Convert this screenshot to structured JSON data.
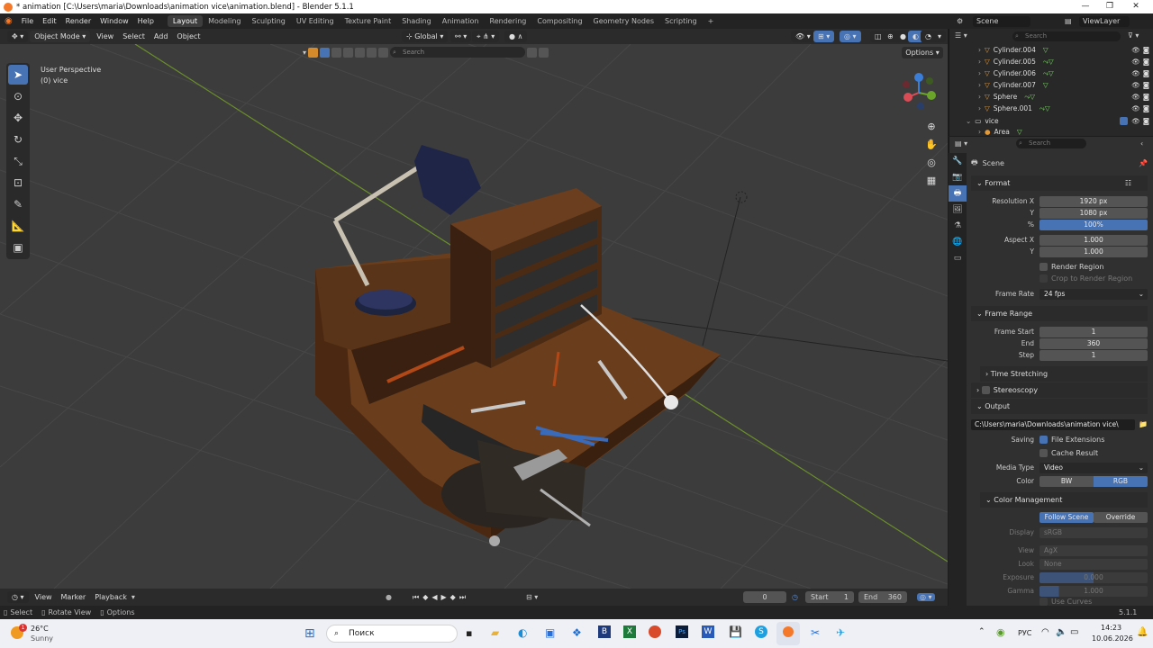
{
  "window": {
    "title": "* animation [C:\\Users\\maria\\Downloads\\animation vice\\animation.blend] - Blender 5.1.1"
  },
  "menu": [
    "File",
    "Edit",
    "Render",
    "Window",
    "Help"
  ],
  "workspaces": [
    "Layout",
    "Modeling",
    "Sculpting",
    "UV Editing",
    "Texture Paint",
    "Shading",
    "Animation",
    "Rendering",
    "Compositing",
    "Geometry Nodes",
    "Scripting"
  ],
  "active_workspace": "Layout",
  "scene_selector": "Scene",
  "viewlayer_selector": "ViewLayer",
  "viewport_header": {
    "mode": "Object Mode",
    "menus": [
      "View",
      "Select",
      "Add",
      "Object"
    ],
    "orientation": "Global"
  },
  "viewport": {
    "perspective": "User Perspective",
    "object_label": "(0) vice",
    "options_label": "Options",
    "search_placeholder": "Search"
  },
  "outliner": {
    "search_placeholder": "Search",
    "items": [
      {
        "name": "Cylinder.004"
      },
      {
        "name": "Cylinder.005"
      },
      {
        "name": "Cylinder.006"
      },
      {
        "name": "Cylinder.007"
      },
      {
        "name": "Sphere"
      },
      {
        "name": "Sphere.001"
      },
      {
        "name": "vice"
      },
      {
        "name": "Area"
      }
    ]
  },
  "properties": {
    "search_placeholder": "Search",
    "context": "Scene",
    "format": {
      "header": "Format",
      "resolution_x_label": "Resolution X",
      "resolution_x": "1920 px",
      "y_label": "Y",
      "resolution_y": "1080 px",
      "pct_label": "%",
      "resolution_pct": "100%",
      "aspect_x_label": "Aspect X",
      "aspect_x": "1.000",
      "aspect_y": "1.000",
      "render_region": "Render Region",
      "crop_region": "Crop to Render Region",
      "frame_rate_label": "Frame Rate",
      "frame_rate": "24 fps"
    },
    "frame_range": {
      "header": "Frame Range",
      "start_label": "Frame Start",
      "start": "1",
      "end_label": "End",
      "end": "360",
      "step_label": "Step",
      "step": "1"
    },
    "time_stretching": "Time Stretching",
    "stereoscopy": "Stereoscopy",
    "output": {
      "header": "Output",
      "path": "C:\\Users\\maria\\Downloads\\animation vice\\",
      "saving_label": "Saving",
      "file_ext": "File Extensions",
      "cache": "Cache Result",
      "media_type_label": "Media Type",
      "media_type": "Video",
      "color_label": "Color",
      "color_bw": "BW",
      "color_rgb": "RGB"
    },
    "color_management": {
      "header": "Color Management",
      "follow": "Follow Scene",
      "override": "Override",
      "display_label": "Display",
      "display": "sRGB",
      "view_label": "View",
      "view": "AgX",
      "look_label": "Look",
      "look": "None",
      "exposure_label": "Exposure",
      "exposure": "0.000",
      "gamma_label": "Gamma",
      "gamma": "1.000",
      "use_curves": "Use Curves"
    }
  },
  "timeline": {
    "menus": [
      "View",
      "Marker",
      "Playback"
    ],
    "current": "0",
    "start_label": "Start",
    "start": "1",
    "end_label": "End",
    "end": "360"
  },
  "statusbar": {
    "select": "Select",
    "rotate": "Rotate View",
    "options": "Options",
    "version": "5.1.1"
  },
  "taskbar": {
    "weather_temp": "26°C",
    "weather": "Sunny",
    "search": "Поиск",
    "lang": "РУС",
    "time": "14:23",
    "date": "10.06.2026",
    "badge": "1"
  },
  "colors": {
    "accent": "#4772b3",
    "viewport_bg": "#3c3c3c"
  }
}
